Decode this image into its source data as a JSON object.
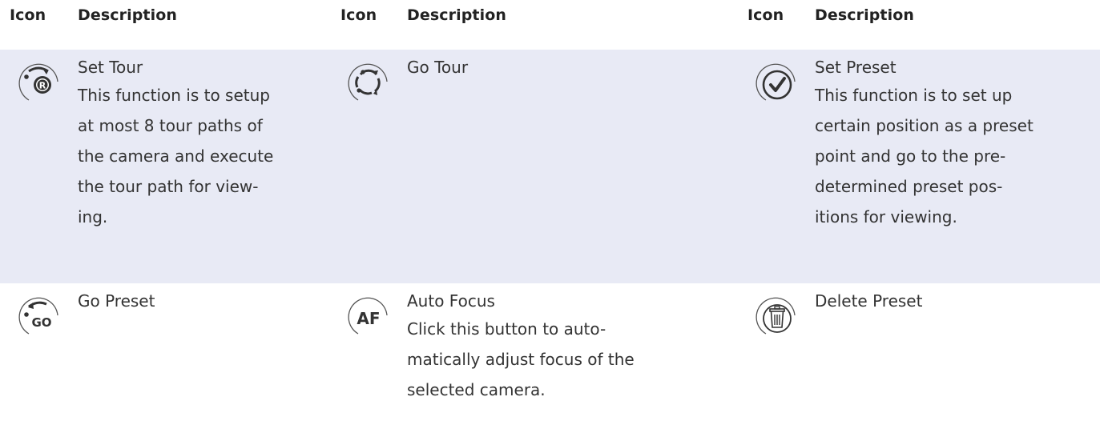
{
  "headers": [
    "Icon",
    "Description",
    "Icon",
    "Description",
    "Icon",
    "Description"
  ],
  "rows": [
    [
      {
        "icon": "set-tour-icon",
        "title": "Set Tour",
        "lines": [
          "This function is to setup",
          "at most 8 tour paths of",
          "the camera and execute",
          "the tour path for view-",
          "ing."
        ]
      },
      {
        "icon": "go-tour-icon",
        "title": "Go Tour",
        "lines": []
      },
      {
        "icon": "set-preset-icon",
        "title": "Set Preset",
        "lines": [
          "This function is to set up",
          "certain position as a preset",
          "point and go to the pre-",
          "determined preset pos-",
          "itions for viewing."
        ]
      }
    ],
    [
      {
        "icon": "go-preset-icon",
        "title": "Go Preset",
        "lines": []
      },
      {
        "icon": "auto-focus-icon",
        "title": "Auto Focus",
        "lines": [
          "Click this button to auto-",
          "matically adjust focus of the",
          "selected camera."
        ]
      },
      {
        "icon": "delete-preset-icon",
        "title": "Delete Preset",
        "lines": []
      }
    ]
  ],
  "icon_text": {
    "af": "AF",
    "go": "GO",
    "r": "R"
  },
  "colors": {
    "row_highlight": "#e8eaf5",
    "text": "#333333",
    "icon_stroke": "#555555"
  }
}
